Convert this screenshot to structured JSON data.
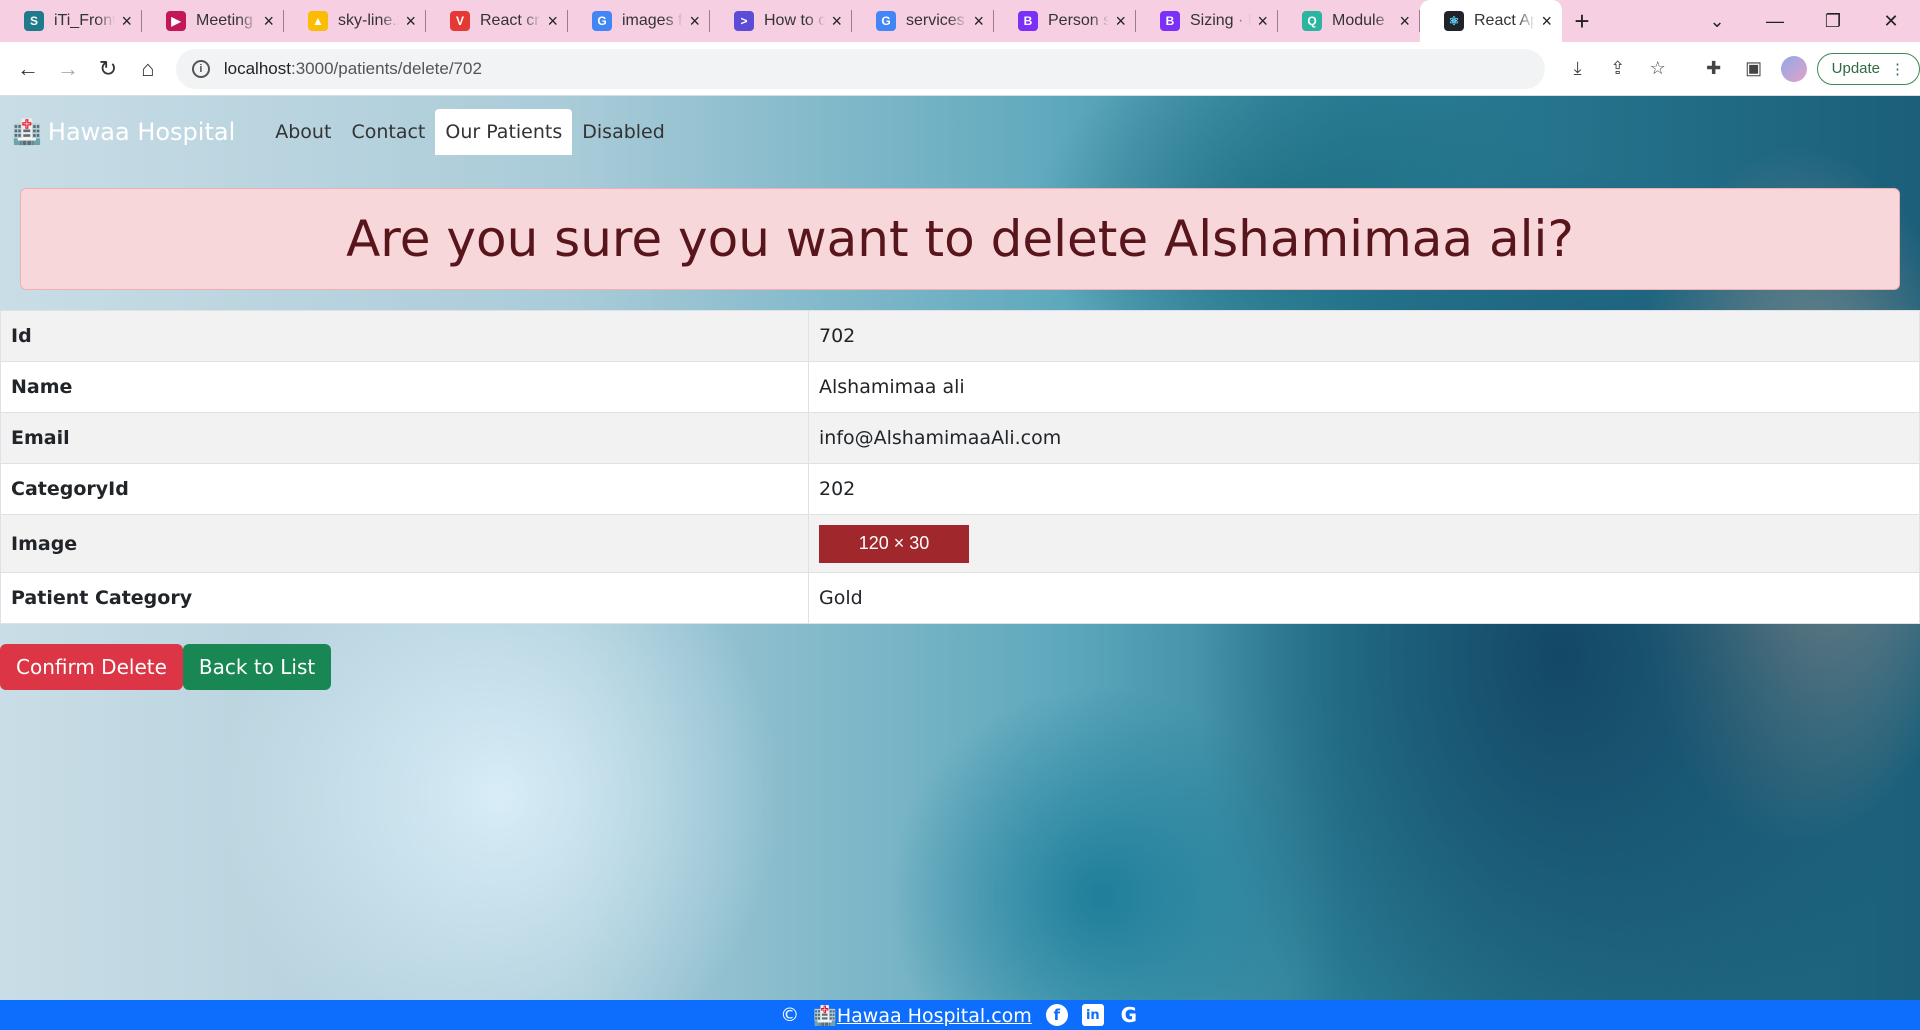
{
  "browser": {
    "tabs": [
      {
        "title": "iTi_Front",
        "favicon_color": "#1f7a8c",
        "favicon_letter": "S"
      },
      {
        "title": "Meeting",
        "favicon_color": "#c2185b",
        "favicon_letter": "▶"
      },
      {
        "title": "sky-line.z",
        "favicon_color": "#fbbc04",
        "favicon_letter": "▲"
      },
      {
        "title": "React cre",
        "favicon_color": "#e53935",
        "favicon_letter": "V"
      },
      {
        "title": "images f",
        "favicon_color": "#4285f4",
        "favicon_letter": "G"
      },
      {
        "title": "How to c",
        "favicon_color": "#5b4bd6",
        "favicon_letter": ">"
      },
      {
        "title": "services",
        "favicon_color": "#4285f4",
        "favicon_letter": "G"
      },
      {
        "title": "Person s",
        "favicon_color": "#7b2ff7",
        "favicon_letter": "B"
      },
      {
        "title": "Sizing · B",
        "favicon_color": "#7b2ff7",
        "favicon_letter": "B"
      },
      {
        "title": "Module",
        "favicon_color": "#2bb5a0",
        "favicon_letter": "Q"
      },
      {
        "title": "React Ap",
        "favicon_color": "#20232a",
        "favicon_letter": "⚛",
        "active": true
      }
    ],
    "address": {
      "host": "localhost",
      "path": ":3000/patients/delete/702"
    },
    "update_label": "Update"
  },
  "app": {
    "brand": "Hawaa Hospital",
    "nav": [
      {
        "label": "About",
        "active": false
      },
      {
        "label": "Contact",
        "active": false
      },
      {
        "label": "Our Patients",
        "active": true
      },
      {
        "label": "Disabled",
        "active": false
      }
    ],
    "alert": "Are you sure you want to delete Alshamimaa ali?",
    "details": [
      {
        "label": "Id",
        "value": "702"
      },
      {
        "label": "Name",
        "value": "Alshamimaa ali"
      },
      {
        "label": "Email",
        "value": "info@AlshamimaaAli.com"
      },
      {
        "label": "CategoryId",
        "value": "202"
      },
      {
        "label": "Image",
        "value": "120 × 30"
      },
      {
        "label": "Patient Category",
        "value": "Gold"
      }
    ],
    "buttons": {
      "confirm": "Confirm Delete",
      "back": "Back to List"
    },
    "footer": {
      "copyright": "©",
      "link": "Hawaa Hospital.com"
    },
    "colors": {
      "alert_bg": "#f8d7da",
      "danger": "#dc3545",
      "success": "#198754",
      "footer": "#0d6efd",
      "image_placeholder": "#a0272c"
    }
  }
}
